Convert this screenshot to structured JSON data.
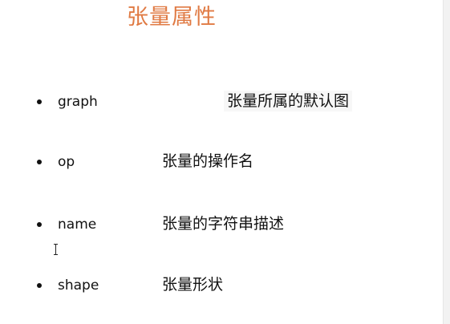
{
  "slide": {
    "title": "张量属性",
    "items": [
      {
        "term": "graph",
        "description": "张量所属的默认图"
      },
      {
        "term": "op",
        "description": "张量的操作名"
      },
      {
        "term": "name",
        "description": "张量的字符串描述"
      },
      {
        "term": "shape",
        "description": "张量形状"
      }
    ]
  },
  "colors": {
    "title": "#e07a43",
    "text": "#111111",
    "background": "#ffffff"
  },
  "icons": {
    "bullet": "bullet-dot",
    "cursor": "text-cursor-icon"
  }
}
